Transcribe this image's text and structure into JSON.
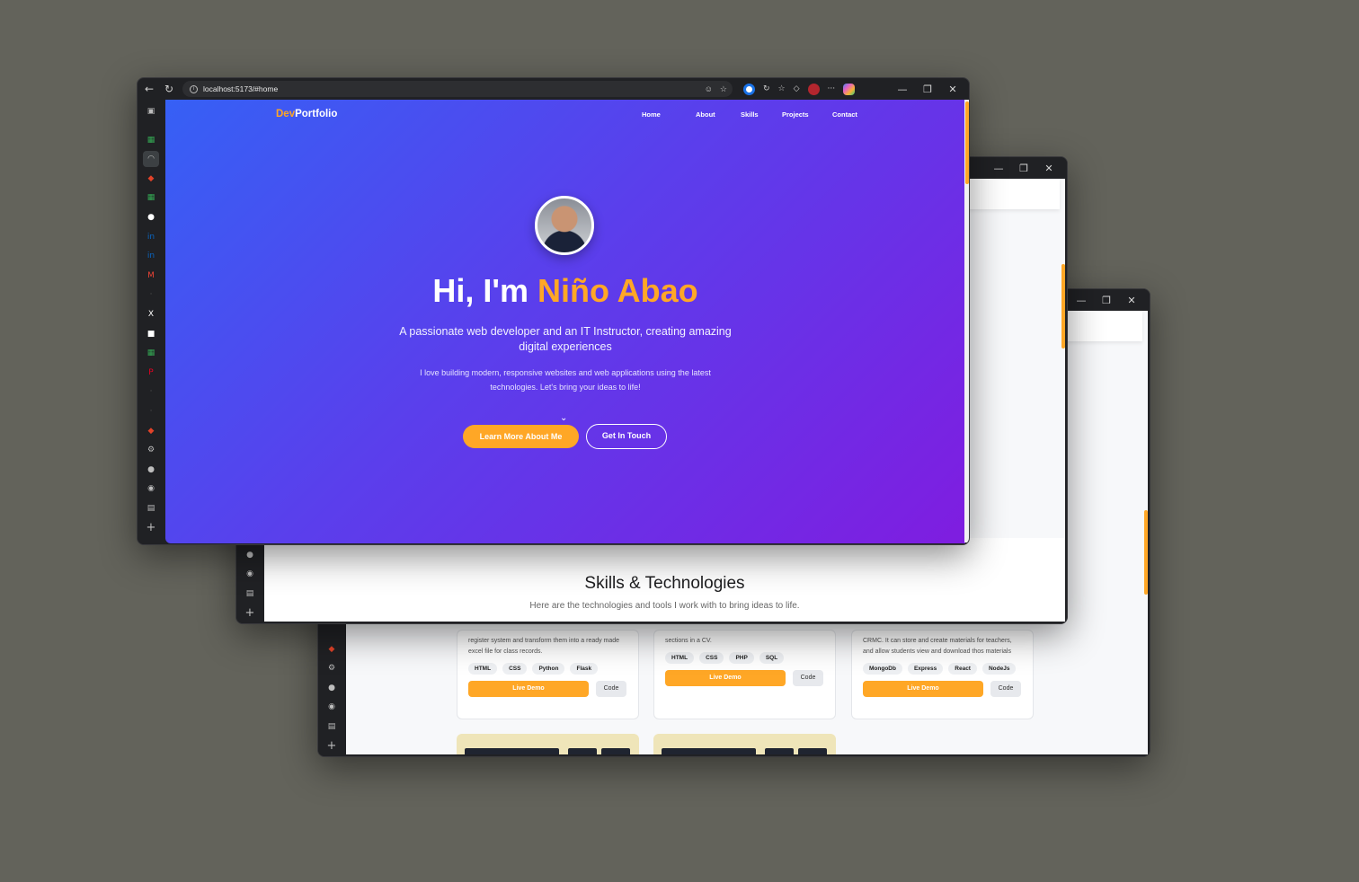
{
  "colors": {
    "accent": "#ffa726",
    "hero_start": "#3660f5",
    "hero_end": "#7f1de0",
    "backdrop": "#63635b"
  },
  "window_controls": {
    "minimize_icon": "—",
    "restore_icon": "❐",
    "close_icon": "✕"
  },
  "back_window": {
    "cards": [
      {
        "description": "register system and transform them into a ready made excel file for class records.",
        "tags": [
          "HTML",
          "CSS",
          "Python",
          "Flask"
        ],
        "live_label": "Live Demo",
        "code_label": "Code"
      },
      {
        "description": "sections in a CV.",
        "tags": [
          "HTML",
          "CSS",
          "PHP",
          "SQL"
        ],
        "live_label": "Live Demo",
        "code_label": "Code"
      },
      {
        "description": "CRMC. It can store and create materials for teachers, and allow students view and download thos materials",
        "tags": [
          "MongoDb",
          "Express",
          "React",
          "NodeJs"
        ],
        "live_label": "Live Demo",
        "code_label": "Code"
      }
    ]
  },
  "mid_window": {
    "skills_title": "Skills & Technologies",
    "skills_subtitle": "Here are the technologies and tools I work with to bring ideas to life."
  },
  "browser": {
    "url": "localhost:5173/#home",
    "back_icon": "←",
    "reload_icon": "↻",
    "more_icon": "···"
  },
  "hero": {
    "logo_dev": "Dev",
    "logo_rest": "Portfolio",
    "nav": [
      "Home",
      "About",
      "Skills",
      "Projects",
      "Contact"
    ],
    "greeting": "Hi, I'm ",
    "name": "Niño Abao",
    "subtitle": "A passionate web developer and an IT Instructor, creating amazing digital experiences",
    "description": "I love building modern, responsive websites and web applications using the latest technologies. Let's bring your ideas to life!",
    "primary_button": "Learn More About Me",
    "secondary_button": "Get In Touch"
  }
}
